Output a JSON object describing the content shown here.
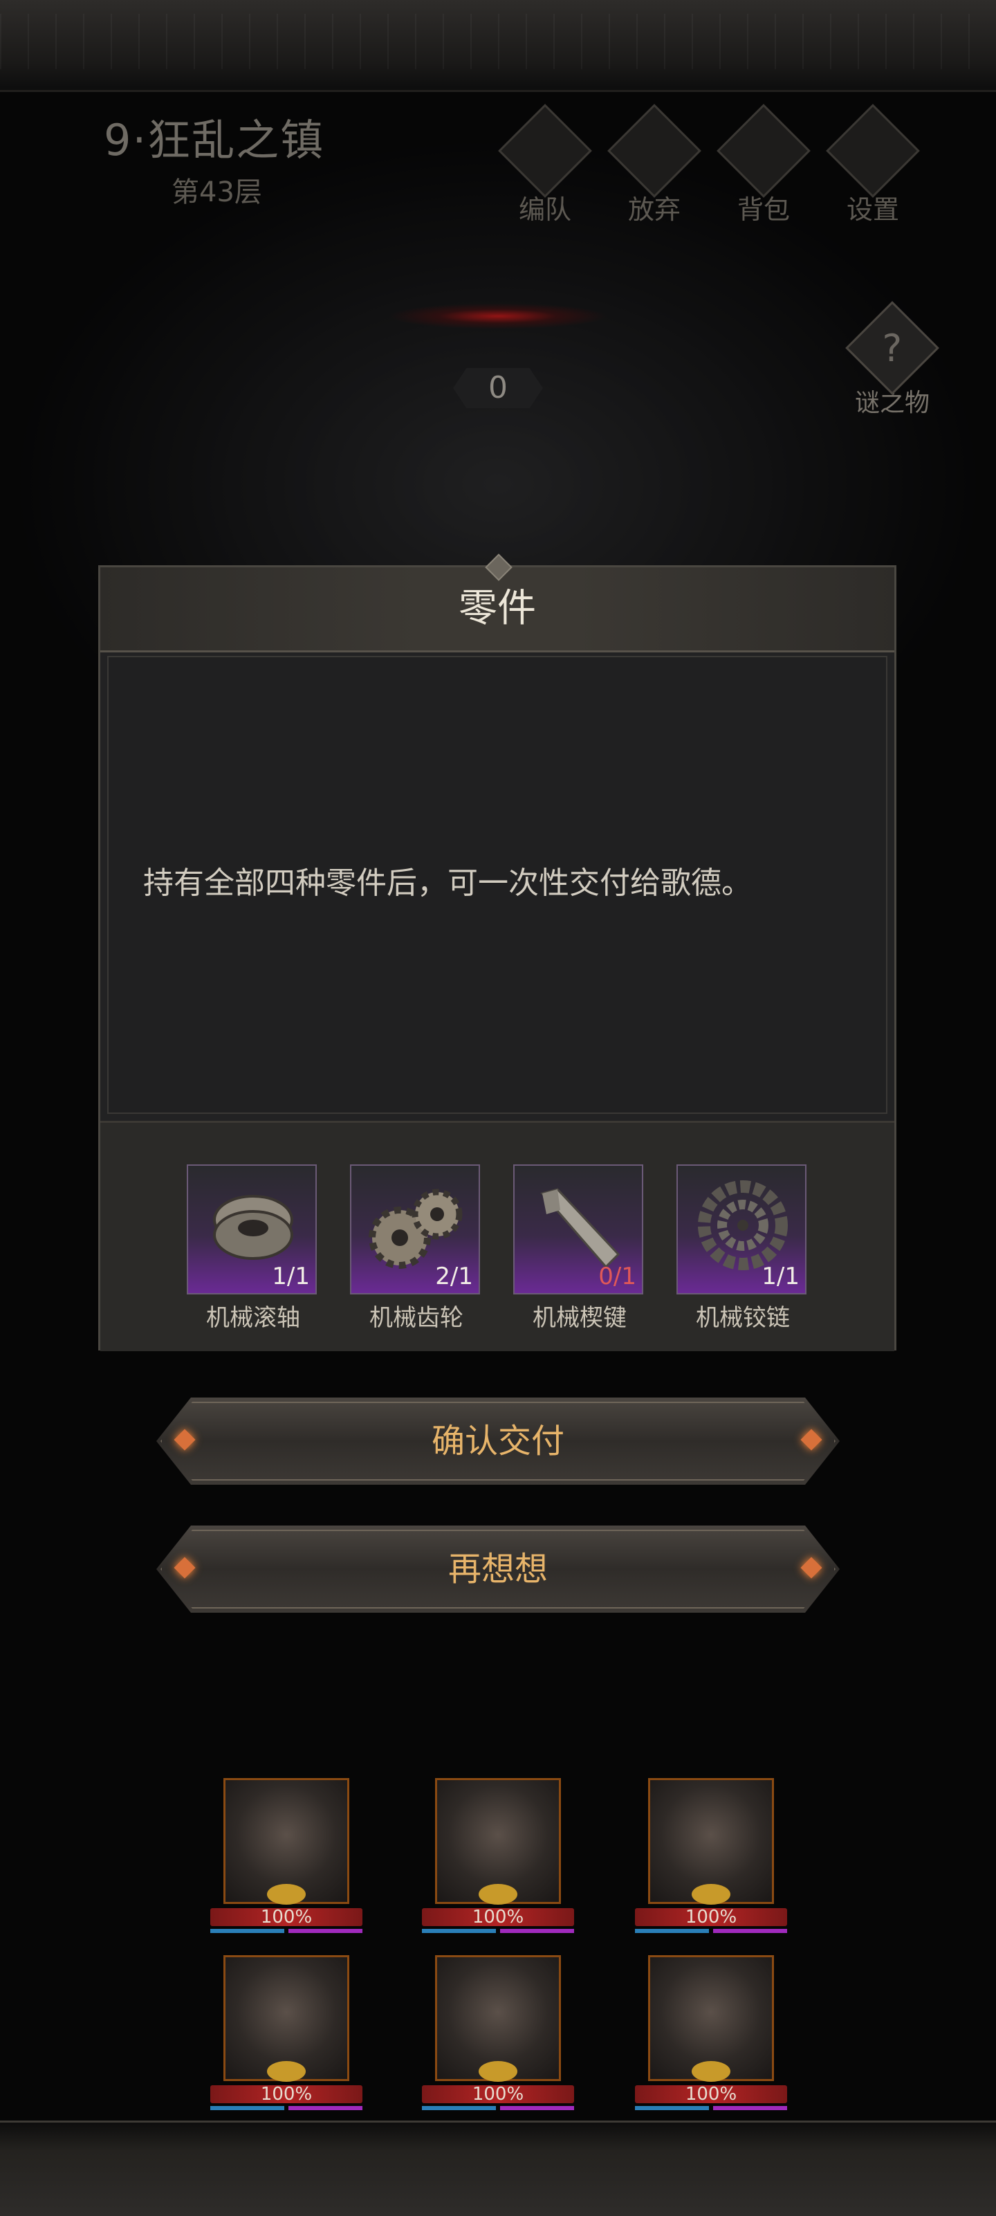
{
  "header": {
    "stage_title": "9·狂乱之镇",
    "floor": "第43层",
    "menu": [
      {
        "label": "编队",
        "icon": "team-icon"
      },
      {
        "label": "放弃",
        "icon": "flag-icon"
      },
      {
        "label": "背包",
        "icon": "bag-icon"
      },
      {
        "label": "设置",
        "icon": "gear-icon"
      }
    ],
    "enigma_label": "谜之物",
    "counter": "0"
  },
  "dialog": {
    "title": "零件",
    "description": "持有全部四种零件后，可一次性交付给歌德。",
    "items": [
      {
        "name": "机械滚轴",
        "count": "1/1",
        "satisfied": true
      },
      {
        "name": "机械齿轮",
        "count": "2/1",
        "satisfied": true
      },
      {
        "name": "机械楔键",
        "count": "0/1",
        "satisfied": false
      },
      {
        "name": "机械铰链",
        "count": "1/1",
        "satisfied": true
      }
    ]
  },
  "buttons": {
    "confirm": "确认交付",
    "cancel": "再想想"
  },
  "party": [
    {
      "hp": "100%"
    },
    {
      "hp": "100%"
    },
    {
      "hp": "100%"
    },
    {
      "hp": "100%"
    },
    {
      "hp": "100%"
    },
    {
      "hp": "100%"
    }
  ],
  "colors": {
    "accent_gold": "#e7b46a",
    "count_bad": "#e05858",
    "rarity_purple": "#6a2a94"
  }
}
